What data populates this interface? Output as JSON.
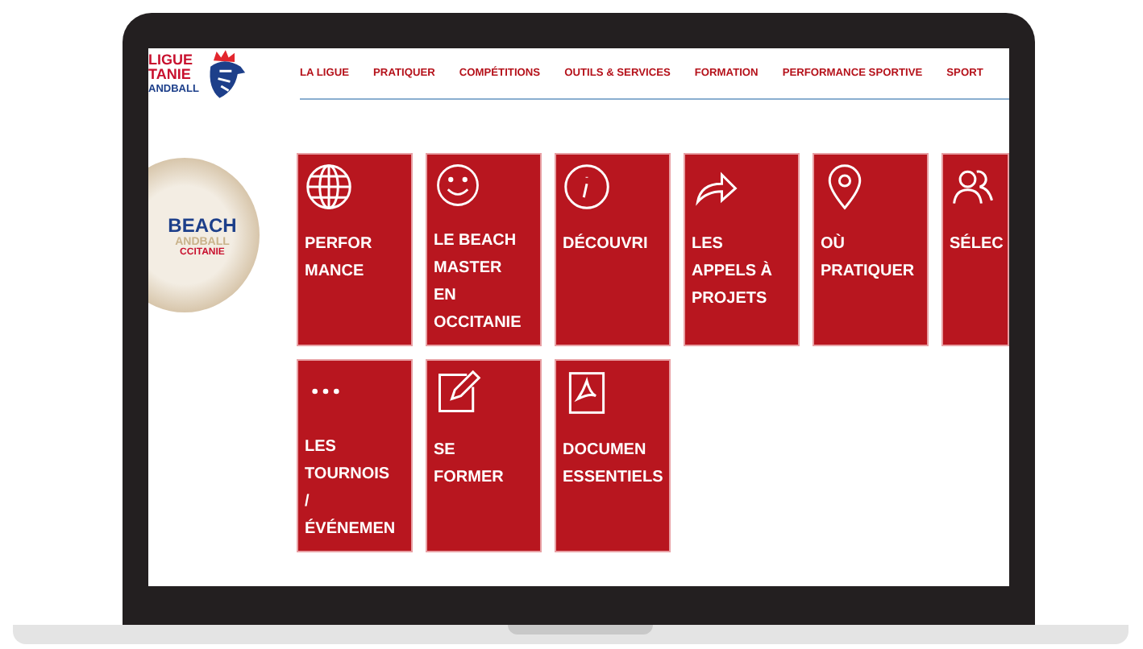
{
  "logo": {
    "lines": [
      "LIGUE",
      "TANIE",
      "ANDBALL"
    ]
  },
  "nav": [
    "LA LIGUE",
    "PRATIQUER",
    "COMPÉTITIONS",
    "OUTILS & SERVICES",
    "FORMATION",
    "PERFORMANCE SPORTIVE",
    "SPORT"
  ],
  "badge": {
    "title": "BEACH",
    "subtitle": "ANDBALL",
    "region": "CCITANIE"
  },
  "tiles": [
    {
      "kind": "globe",
      "label": [
        "PERFOR",
        "MANCE"
      ]
    },
    {
      "kind": "smiley",
      "label": [
        "LE BEACH",
        "MASTER",
        "EN",
        "OCCITANIE"
      ]
    },
    {
      "kind": "info",
      "label": [
        "DÉCOUVRI"
      ]
    },
    {
      "kind": "share",
      "label": [
        "LES",
        "APPELS À",
        "PROJETS"
      ]
    },
    {
      "kind": "pin",
      "label": [
        "OÙ",
        "PRATIQUER"
      ]
    },
    {
      "kind": "users",
      "label": [
        "SÉLEC"
      ]
    },
    {
      "kind": "dots",
      "label": [
        "LES",
        "TOURNOIS",
        "/",
        "ÉVÉNEMEN"
      ]
    },
    {
      "kind": "edit",
      "label": [
        "SE",
        "FORMER"
      ]
    },
    {
      "kind": "pdf",
      "label": [
        "DOCUMEN",
        "ESSENTIELS"
      ]
    }
  ]
}
